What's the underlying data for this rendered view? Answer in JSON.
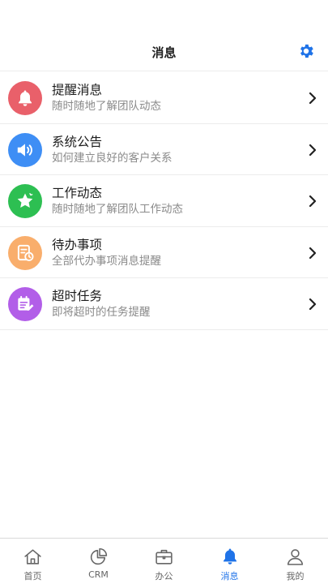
{
  "header": {
    "title": "消息"
  },
  "messages": [
    {
      "title": "提醒消息",
      "subtitle": "随时随地了解团队动态",
      "icon": "bell-icon",
      "color": "#e9606a"
    },
    {
      "title": "系统公告",
      "subtitle": "如何建立良好的客户关系",
      "icon": "speaker-icon",
      "color": "#3e8ef5"
    },
    {
      "title": "工作动态",
      "subtitle": "随时随地了解团队工作动态",
      "icon": "star-icon",
      "color": "#2dbf52"
    },
    {
      "title": "待办事项",
      "subtitle": "全部代办事项消息提醒",
      "icon": "clipboard-clock-icon",
      "color": "#f9ae6c"
    },
    {
      "title": "超时任务",
      "subtitle": "即将超时的任务提醒",
      "icon": "task-edit-icon",
      "color": "#b25ee8"
    }
  ],
  "tabs": [
    {
      "label": "首页",
      "icon": "home-icon",
      "active": false
    },
    {
      "label": "CRM",
      "icon": "pie-chart-icon",
      "active": false
    },
    {
      "label": "办公",
      "icon": "briefcase-icon",
      "active": false
    },
    {
      "label": "消息",
      "icon": "bell-icon",
      "active": true
    },
    {
      "label": "我的",
      "icon": "user-icon",
      "active": false
    }
  ],
  "colors": {
    "accent": "#1f73e8",
    "text": "#1c1c1c",
    "subtext": "#8a8a8a",
    "divider": "#ececec"
  }
}
